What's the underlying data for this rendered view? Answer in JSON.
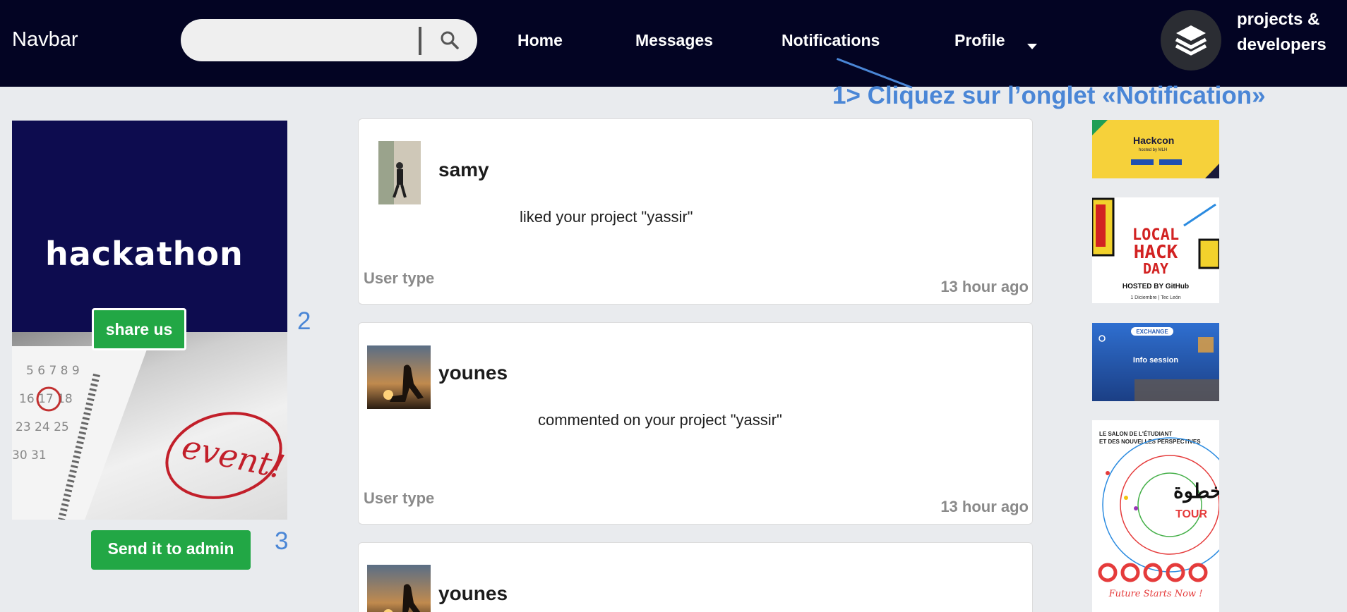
{
  "navbar": {
    "brand": "Navbar",
    "search": {
      "placeholder": "",
      "icon": "search-icon"
    },
    "links": [
      "Home",
      "Messages",
      "Notifications",
      "Profile"
    ],
    "logo_icon": "layers-icon",
    "logo_text_line1": "projects &",
    "logo_text_line2": "developers"
  },
  "annotations": {
    "step1": "1> Cliquez sur l’onglet «Notification»",
    "step2": "2",
    "step3": "3"
  },
  "promo": {
    "title": "hackathon",
    "handwritten": "event!",
    "share_label": "share us",
    "admin_label": "Send it to admin"
  },
  "notifications": [
    {
      "user": "samy",
      "message": "liked your project \"yassir\"",
      "user_type": "User type",
      "time": "13 hour ago"
    },
    {
      "user": "younes",
      "message": "commented on your project \"yassir\"",
      "user_type": "User type",
      "time": "13 hour ago"
    },
    {
      "user": "younes"
    }
  ],
  "ads": {
    "ad1": {
      "title": "Hackcon",
      "subtitle": "hosted by MLH"
    },
    "ad2": {
      "line1": "LOCAL",
      "line2": "HACK",
      "line3": "DAY",
      "host": "HOSTED BY GitHub",
      "date": "1 Diciembre | Tec León"
    },
    "ad3": {
      "brand": "EXCHANGE",
      "title": "Info session"
    },
    "ad4": {
      "line1": "LE SALON DE L'ÉTUDIANT",
      "line2": "ET DES NOUVELLES PERSPECTIVES",
      "tour": "TOUR",
      "tagline": "Future Starts Now !"
    }
  },
  "colors": {
    "navbar": "#030423",
    "accent_green": "#22a745",
    "annotation_blue": "#4a86d6",
    "background": "#e9ebee"
  }
}
